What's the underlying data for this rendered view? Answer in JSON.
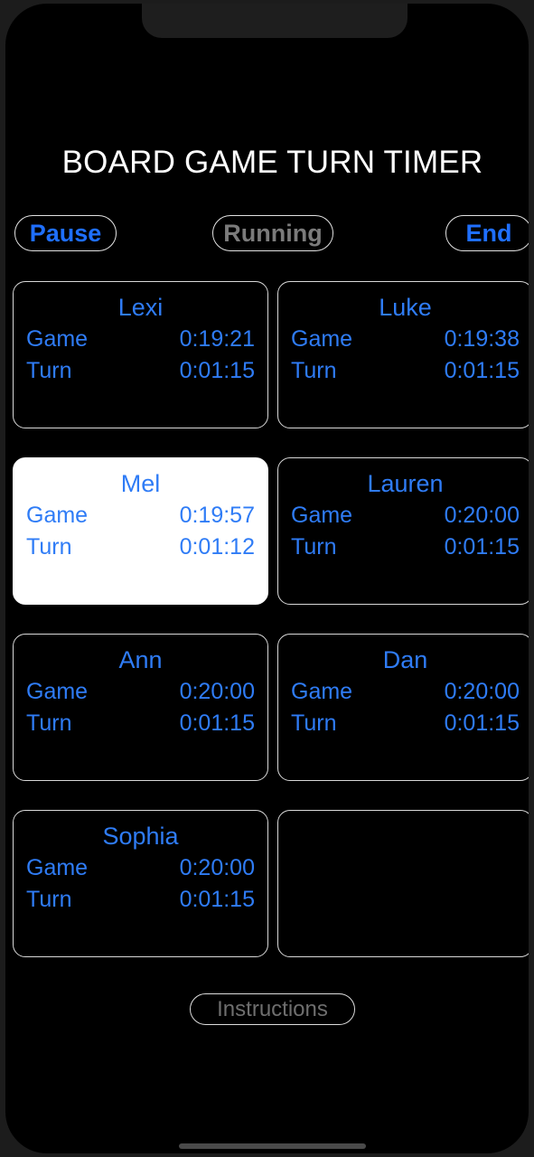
{
  "app": {
    "title": "BOARD GAME TURN TIMER"
  },
  "controls": {
    "pause_label": "Pause",
    "status_label": "Running",
    "end_label": "End"
  },
  "labels": {
    "game": "Game",
    "turn": "Turn"
  },
  "players": [
    {
      "name": "Lexi",
      "game_label": "Game",
      "game_time": "0:19:21",
      "turn_label": "Turn",
      "turn_time": "0:01:15",
      "active": false,
      "empty": false
    },
    {
      "name": "Luke",
      "game_label": "Game",
      "game_time": "0:19:38",
      "turn_label": "Turn",
      "turn_time": "0:01:15",
      "active": false,
      "empty": false
    },
    {
      "name": "Mel",
      "game_label": "Game",
      "game_time": "0:19:57",
      "turn_label": "Turn",
      "turn_time": "0:01:12",
      "active": true,
      "empty": false
    },
    {
      "name": "Lauren",
      "game_label": "Game",
      "game_time": "0:20:00",
      "turn_label": "Turn",
      "turn_time": "0:01:15",
      "active": false,
      "empty": false
    },
    {
      "name": "Ann",
      "game_label": "Game",
      "game_time": "0:20:00",
      "turn_label": "Turn",
      "turn_time": "0:01:15",
      "active": false,
      "empty": false
    },
    {
      "name": "Dan",
      "game_label": "Game",
      "game_time": "0:20:00",
      "turn_label": "Turn",
      "turn_time": "0:01:15",
      "active": false,
      "empty": false
    },
    {
      "name": "Sophia",
      "game_label": "Game",
      "game_time": "0:20:00",
      "turn_label": "Turn",
      "turn_time": "0:01:15",
      "active": false,
      "empty": false
    },
    {
      "name": "",
      "game_label": "",
      "game_time": "",
      "turn_label": "",
      "turn_time": "",
      "active": false,
      "empty": true
    }
  ],
  "footer": {
    "instructions_label": "Instructions"
  },
  "colors": {
    "accent_blue": "#2f7cf6",
    "button_blue": "#1f6fff",
    "status_gray": "#7b7b7b",
    "instructions_gray": "#6e6e6e",
    "card_border": "#d8d8d8",
    "active_card_bg": "#ffffff",
    "screen_bg": "#000000",
    "title_white": "#ffffff",
    "home_indicator": "#4a4a4a"
  }
}
